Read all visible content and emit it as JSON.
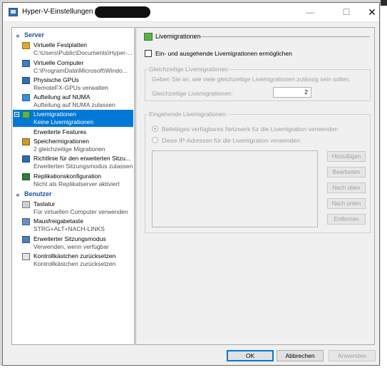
{
  "window": {
    "title": "Hyper-V-Einstellungen für"
  },
  "tree": {
    "sections": [
      {
        "label": "Server",
        "chevron": "«"
      },
      {
        "label": "Benutzer",
        "chevron": "«"
      }
    ],
    "server_items": [
      {
        "label": "Virtuelle Festplatten",
        "sub": "C:\\Users\\Public\\Documents\\Hyper-...",
        "icon": "disk-icon"
      },
      {
        "label": "Virtuelle Computer",
        "sub": "C:\\ProgramData\\Microsoft\\Windo...",
        "icon": "computer-icon"
      },
      {
        "label": "Physische GPUs",
        "sub": "RemoteFX-GPUs verwalten",
        "icon": "gpu-icon"
      },
      {
        "label": "Aufteilung auf NUMA",
        "sub": "Aufteilung auf NUMA zulassen",
        "icon": "numa-icon"
      },
      {
        "label": "Livemigrationen",
        "sub": "Keine Livemigrationen",
        "icon": "live-migration-icon",
        "selected": true
      },
      {
        "label": "Erweiterte Features",
        "sub": ""
      },
      {
        "label": "Speichermigrationen",
        "sub": "2 gleichzeitige Migrationen",
        "icon": "storage-migration-icon"
      },
      {
        "label": "Richtlinie für den erweiterten Sitzu...",
        "sub": "Erweiterten Sitzungsmodus zulassen",
        "icon": "policy-icon"
      },
      {
        "label": "Replikationskonfiguration",
        "sub": "Nicht als Replikatserver aktiviert",
        "icon": "replication-icon"
      }
    ],
    "user_items": [
      {
        "label": "Tastatur",
        "sub": "Für virtuellen Computer verwenden",
        "icon": "keyboard-icon"
      },
      {
        "label": "Mausfreigabetaste",
        "sub": "STRG+ALT+NACH-LINKS",
        "icon": "mouse-icon"
      },
      {
        "label": "Erweiterter Sitzungsmodus",
        "sub": "Verwenden, wenn verfügbar",
        "icon": "session-icon"
      },
      {
        "label": "Kontrollkästchen zurücksetzen",
        "sub": "Kontrollkästchen zurücksetzen",
        "icon": "checkbox-reset-icon"
      }
    ]
  },
  "panel": {
    "heading": "Livemigrationen",
    "enable_checkbox_label": "Ein- und ausgehende Livemigrationen ermöglichen",
    "enable_checked": false,
    "simultaneous": {
      "legend": "Gleichzeitige Livemigrationen",
      "description": "Geben Sie an, wie viele gleichzeitige Livemigrationen zulässig sein sollen.",
      "field_label": "Gleichzeitige Livemigrationen:",
      "value": "2"
    },
    "incoming": {
      "legend": "Eingehende Livemigrationen",
      "radio_any": "Beliebiges verfügbares Netzwerk für die Livemigration verwenden",
      "radio_ip": "Diese IP-Adressen für die Livemigration verwenden:",
      "buttons": [
        "Hinzufügen",
        "Bearbeiten",
        "Nach oben",
        "Nach unten",
        "Entfernen"
      ]
    }
  },
  "footer": {
    "ok": "OK",
    "cancel": "Abbrechen",
    "apply": "Anwenden"
  }
}
